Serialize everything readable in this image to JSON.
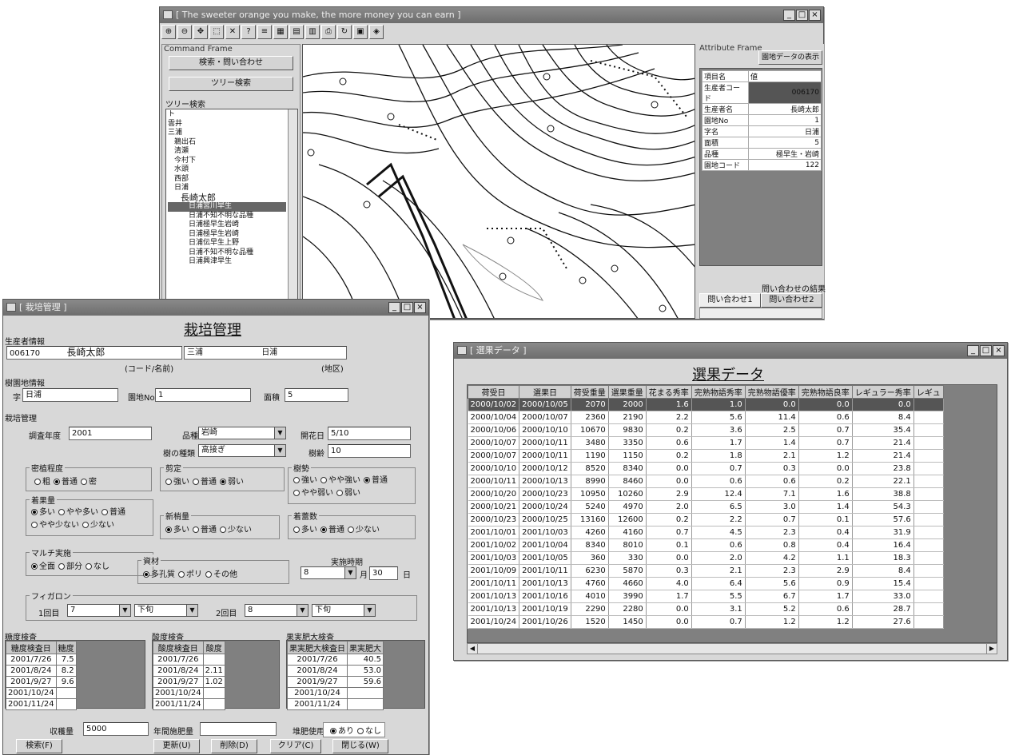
{
  "map_window": {
    "title": "[ The sweeter orange you make, the more money you can earn ]",
    "command_frame_title": "Command Frame",
    "search_button": "検索・問い合わせ",
    "tree_button": "ツリー検索",
    "tree_group_title": "ツリー検索",
    "tree_items": [
      "ト",
      "雲井",
      "三浦",
      "鵜出石",
      "清瀬",
      "今村下",
      "水頭",
      "西部",
      "日浦",
      "長崎太郎",
      "日浦宮川早生",
      "日浦不知不明な品種",
      "日浦極早生岩崎",
      "日浦極早生岩崎",
      "日浦伝早生上野",
      "日浦不知不明な品種",
      "日浦興津早生"
    ],
    "attribute_frame_title": "Attribute Frame",
    "attribute_button": "園地データの表示",
    "attributes": [
      {
        "key": "項目名",
        "value": "値"
      },
      {
        "key": "生産者コード",
        "value": "006170"
      },
      {
        "key": "生産者名",
        "value": "長崎太郎"
      },
      {
        "key": "園地No",
        "value": "1"
      },
      {
        "key": "字名",
        "value": "日浦"
      },
      {
        "key": "面積",
        "value": "5"
      },
      {
        "key": "品種",
        "value": "極早生・岩崎"
      },
      {
        "key": "園地コード",
        "value": "122"
      }
    ],
    "query_result_label": "問い合わせの結果",
    "query_tabs": [
      "問い合わせ1",
      "問い合わせ2"
    ]
  },
  "cultivation_window": {
    "title": "[ 栽培管理 ]",
    "heading": "栽培管理",
    "producer_section": "生産者情報",
    "producer_code": "006170",
    "producer_name": "長崎太郎",
    "district": "三浦",
    "area_name": "日浦",
    "code_name_caption": "(コード/名前)",
    "region_caption": "(地区)",
    "orchard_section": "樹園地情報",
    "place_prefix": "字",
    "place_value": "日浦",
    "orchard_no_label": "園地No",
    "orchard_no": "1",
    "area_label": "面積",
    "area_value": "5",
    "management_section": "栽培管理",
    "survey_year_label": "調査年度",
    "survey_year": "2001",
    "variety_label": "品種",
    "variety": "岩崎",
    "tree_type_label": "樹の種類",
    "tree_type": "高接ぎ",
    "bloom_label": "開花日",
    "bloom_value": "5/10",
    "tree_age_label": "樹齢",
    "tree_age": "10",
    "density_group": "密植程度",
    "density_options": [
      "粗",
      "普通",
      "密"
    ],
    "density_selected": 1,
    "pruning_group": "剪定",
    "pruning_options": [
      "強い",
      "普通",
      "弱い"
    ],
    "pruning_selected": 2,
    "vigor_group": "樹勢",
    "vigor_options": [
      "強い",
      "やや強い",
      "普通",
      "やや弱い",
      "弱い"
    ],
    "vigor_selected": 2,
    "fruit_group": "着果量",
    "fruit_options": [
      "多い",
      "やや多い",
      "普通",
      "やや少ない",
      "少ない"
    ],
    "fruit_selected": 0,
    "fertilizer_group": "新梢量",
    "fertilizer_options": [
      "多い",
      "普通",
      "少ない"
    ],
    "fertilizer_selected": 0,
    "shoot_group": "着蕾数",
    "shoot_options": [
      "多い",
      "普通",
      "少ない"
    ],
    "shoot_selected": 1,
    "mulch_group": "マルチ実施",
    "mulch_options": [
      "全面",
      "部分",
      "なし"
    ],
    "mulch_selected": 0,
    "material_group": "資材",
    "material_options": [
      "多孔質",
      "ポリ",
      "その他"
    ],
    "material_selected": 0,
    "timing_label": "実施時期",
    "timing_month": "8",
    "timing_month_unit": "月",
    "timing_day": "30",
    "timing_day_unit": "日",
    "fiflon_group": "フィガロン",
    "first_label": "1回目",
    "first_month": "7",
    "first_period": "下旬",
    "second_label": "2回目",
    "second_month": "8",
    "second_period": "下旬",
    "sugar_group": "糖度検査",
    "sugar_headers": [
      "糖度検査日",
      "糖度"
    ],
    "sugar_rows": [
      [
        "2001/7/26",
        "7.5"
      ],
      [
        "2001/8/24",
        "8.2"
      ],
      [
        "2001/9/27",
        "9.6"
      ],
      [
        "2001/10/24",
        ""
      ],
      [
        "2001/11/24",
        ""
      ]
    ],
    "acid_group": "酸度検査",
    "acid_headers": [
      "酸度検査日",
      "酸度"
    ],
    "acid_rows": [
      [
        "2001/7/26",
        ""
      ],
      [
        "2001/8/24",
        "2.11"
      ],
      [
        "2001/9/27",
        "1.02"
      ],
      [
        "2001/10/24",
        ""
      ],
      [
        "2001/11/24",
        ""
      ]
    ],
    "size_group": "果実肥大検査",
    "size_headers": [
      "果実肥大検査日",
      "果実肥大"
    ],
    "size_rows": [
      [
        "2001/7/26",
        "40.5"
      ],
      [
        "2001/8/24",
        "53.0"
      ],
      [
        "2001/9/27",
        "59.6"
      ],
      [
        "2001/10/24",
        ""
      ],
      [
        "2001/11/24",
        ""
      ]
    ],
    "harvest_label": "収穫量",
    "harvest_value": "5000",
    "annual_fert_label": "年間施肥量",
    "annual_fert_value": "",
    "compost_label": "堆肥使用",
    "compost_options": [
      "あり",
      "なし"
    ],
    "compost_selected": 0,
    "buttons": [
      "検索(F)",
      "更新(U)",
      "削除(D)",
      "クリア(C)",
      "閉じる(W)"
    ]
  },
  "selection_window": {
    "title": "[ 選果データ ]",
    "heading": "選果データ",
    "headers": [
      "荷受日",
      "選果日",
      "荷受重量",
      "選果重量",
      "花まる秀率",
      "完熟物語秀率",
      "完熟物語優率",
      "完熟物語良率",
      "レギュラー秀率",
      "レギュ"
    ],
    "rows": [
      [
        "2000/10/02",
        "2000/10/05",
        "2070",
        "2000",
        "1.6",
        "1.0",
        "0.0",
        "0.0",
        "0.0",
        ""
      ],
      [
        "2000/10/04",
        "2000/10/07",
        "2360",
        "2190",
        "2.2",
        "5.6",
        "11.4",
        "0.6",
        "8.4",
        ""
      ],
      [
        "2000/10/06",
        "2000/10/10",
        "10670",
        "9830",
        "0.2",
        "3.6",
        "2.5",
        "0.7",
        "35.4",
        ""
      ],
      [
        "2000/10/07",
        "2000/10/11",
        "3480",
        "3350",
        "0.6",
        "1.7",
        "1.4",
        "0.7",
        "21.4",
        ""
      ],
      [
        "2000/10/07",
        "2000/10/11",
        "1190",
        "1150",
        "0.2",
        "1.8",
        "2.1",
        "1.2",
        "21.4",
        ""
      ],
      [
        "2000/10/10",
        "2000/10/12",
        "8520",
        "8340",
        "0.0",
        "0.7",
        "0.3",
        "0.0",
        "23.8",
        ""
      ],
      [
        "2000/10/11",
        "2000/10/13",
        "8990",
        "8460",
        "0.0",
        "0.6",
        "0.6",
        "0.2",
        "22.1",
        ""
      ],
      [
        "2000/10/20",
        "2000/10/23",
        "10950",
        "10260",
        "2.9",
        "12.4",
        "7.1",
        "1.6",
        "38.8",
        ""
      ],
      [
        "2000/10/21",
        "2000/10/24",
        "5240",
        "4970",
        "2.0",
        "6.5",
        "3.0",
        "1.4",
        "54.3",
        ""
      ],
      [
        "2000/10/23",
        "2000/10/25",
        "13160",
        "12600",
        "0.2",
        "2.2",
        "0.7",
        "0.1",
        "57.6",
        ""
      ],
      [
        "2001/10/01",
        "2001/10/03",
        "4260",
        "4160",
        "0.7",
        "4.5",
        "2.3",
        "0.4",
        "31.9",
        ""
      ],
      [
        "2001/10/02",
        "2001/10/04",
        "8340",
        "8010",
        "0.1",
        "0.6",
        "0.8",
        "0.4",
        "16.4",
        ""
      ],
      [
        "2001/10/03",
        "2001/10/05",
        "360",
        "330",
        "0.0",
        "2.0",
        "4.2",
        "1.1",
        "18.3",
        ""
      ],
      [
        "2001/10/09",
        "2001/10/11",
        "6230",
        "5870",
        "0.3",
        "2.1",
        "2.3",
        "2.9",
        "8.4",
        ""
      ],
      [
        "2001/10/11",
        "2001/10/13",
        "4760",
        "4660",
        "4.0",
        "6.4",
        "5.6",
        "0.9",
        "15.4",
        ""
      ],
      [
        "2001/10/13",
        "2001/10/16",
        "4010",
        "3990",
        "1.7",
        "5.5",
        "6.7",
        "1.7",
        "33.0",
        ""
      ],
      [
        "2001/10/13",
        "2001/10/19",
        "2290",
        "2280",
        "0.0",
        "3.1",
        "5.2",
        "0.6",
        "28.7",
        ""
      ],
      [
        "2001/10/24",
        "2001/10/26",
        "1520",
        "1450",
        "0.0",
        "0.7",
        "1.2",
        "1.2",
        "27.6",
        ""
      ]
    ]
  }
}
